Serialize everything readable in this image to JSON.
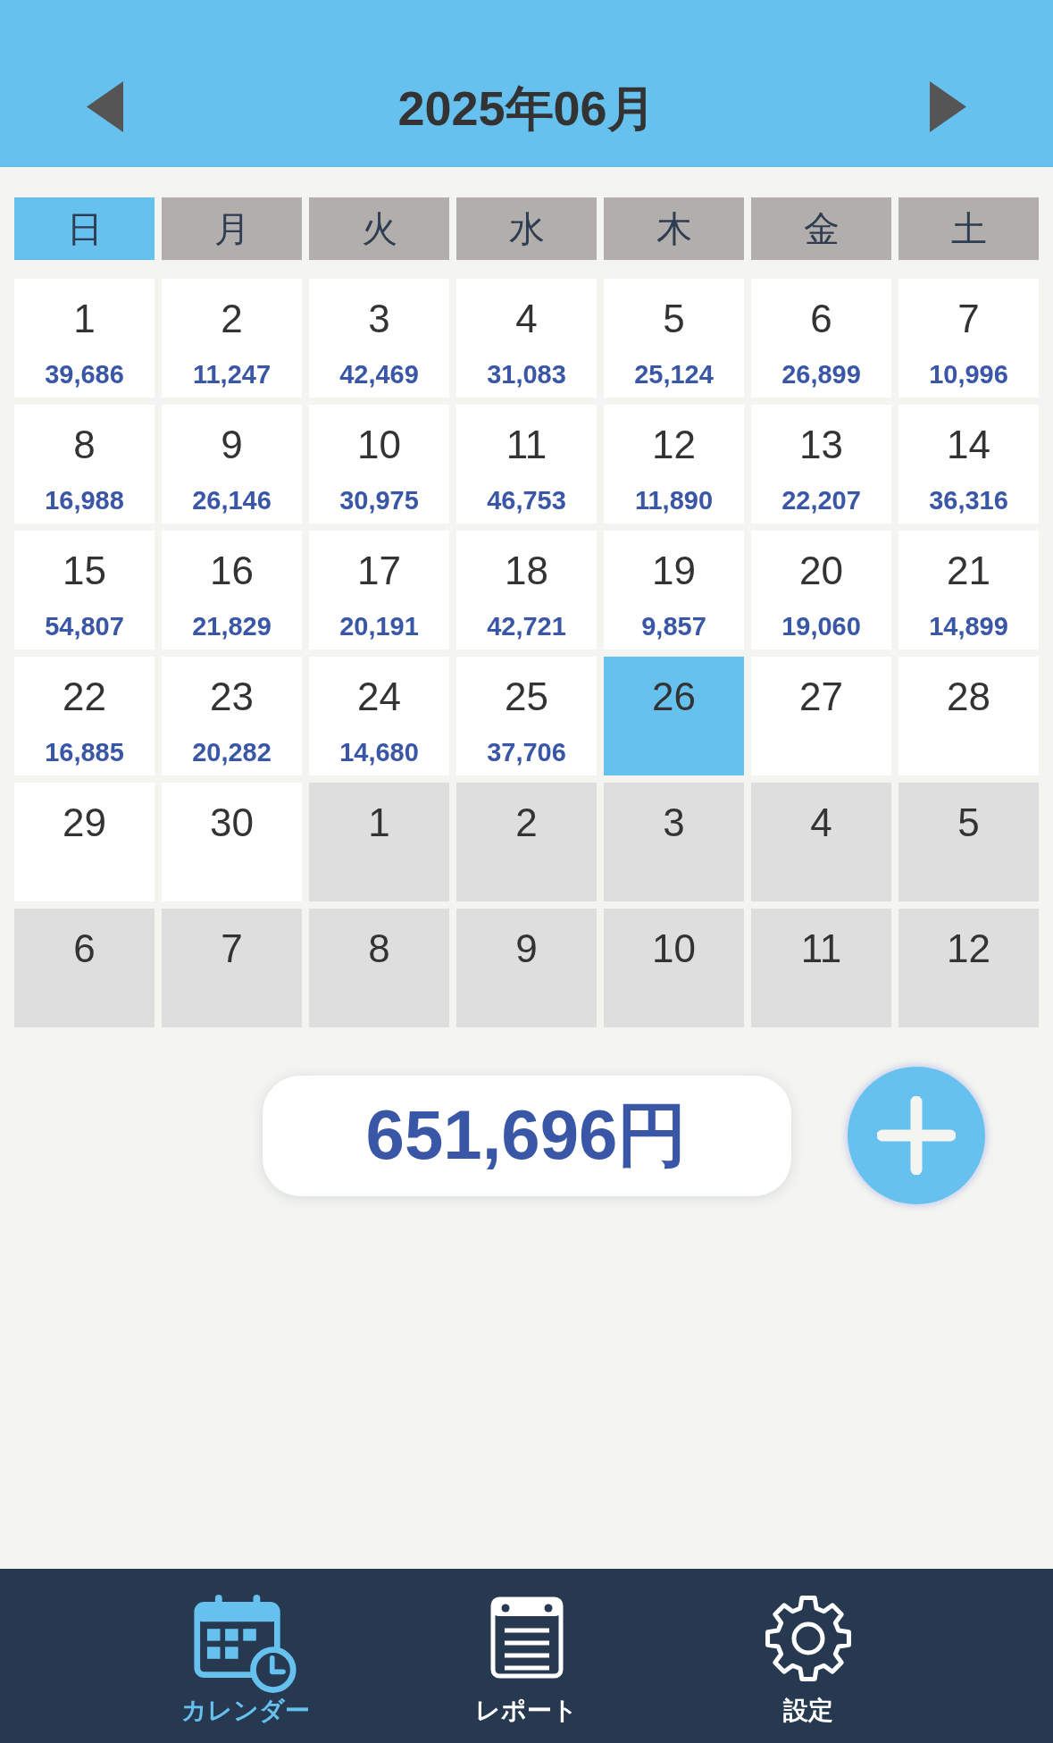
{
  "header": {
    "title": "2025年06月"
  },
  "weekdays": [
    {
      "label": "日",
      "highlighted": true
    },
    {
      "label": "月",
      "highlighted": false
    },
    {
      "label": "火",
      "highlighted": false
    },
    {
      "label": "水",
      "highlighted": false
    },
    {
      "label": "木",
      "highlighted": false
    },
    {
      "label": "金",
      "highlighted": false
    },
    {
      "label": "土",
      "highlighted": false
    }
  ],
  "days": [
    {
      "day": "1",
      "amount": "39,686",
      "in_month": true,
      "today": false
    },
    {
      "day": "2",
      "amount": "11,247",
      "in_month": true,
      "today": false
    },
    {
      "day": "3",
      "amount": "42,469",
      "in_month": true,
      "today": false
    },
    {
      "day": "4",
      "amount": "31,083",
      "in_month": true,
      "today": false
    },
    {
      "day": "5",
      "amount": "25,124",
      "in_month": true,
      "today": false
    },
    {
      "day": "6",
      "amount": "26,899",
      "in_month": true,
      "today": false
    },
    {
      "day": "7",
      "amount": "10,996",
      "in_month": true,
      "today": false
    },
    {
      "day": "8",
      "amount": "16,988",
      "in_month": true,
      "today": false
    },
    {
      "day": "9",
      "amount": "26,146",
      "in_month": true,
      "today": false
    },
    {
      "day": "10",
      "amount": "30,975",
      "in_month": true,
      "today": false
    },
    {
      "day": "11",
      "amount": "46,753",
      "in_month": true,
      "today": false
    },
    {
      "day": "12",
      "amount": "11,890",
      "in_month": true,
      "today": false
    },
    {
      "day": "13",
      "amount": "22,207",
      "in_month": true,
      "today": false
    },
    {
      "day": "14",
      "amount": "36,316",
      "in_month": true,
      "today": false
    },
    {
      "day": "15",
      "amount": "54,807",
      "in_month": true,
      "today": false
    },
    {
      "day": "16",
      "amount": "21,829",
      "in_month": true,
      "today": false
    },
    {
      "day": "17",
      "amount": "20,191",
      "in_month": true,
      "today": false
    },
    {
      "day": "18",
      "amount": "42,721",
      "in_month": true,
      "today": false
    },
    {
      "day": "19",
      "amount": "9,857",
      "in_month": true,
      "today": false
    },
    {
      "day": "20",
      "amount": "19,060",
      "in_month": true,
      "today": false
    },
    {
      "day": "21",
      "amount": "14,899",
      "in_month": true,
      "today": false
    },
    {
      "day": "22",
      "amount": "16,885",
      "in_month": true,
      "today": false
    },
    {
      "day": "23",
      "amount": "20,282",
      "in_month": true,
      "today": false
    },
    {
      "day": "24",
      "amount": "14,680",
      "in_month": true,
      "today": false
    },
    {
      "day": "25",
      "amount": "37,706",
      "in_month": true,
      "today": false
    },
    {
      "day": "26",
      "in_month": true,
      "today": true
    },
    {
      "day": "27",
      "in_month": true,
      "today": false
    },
    {
      "day": "28",
      "in_month": true,
      "today": false
    },
    {
      "day": "29",
      "in_month": true,
      "today": false
    },
    {
      "day": "30",
      "in_month": true,
      "today": false
    },
    {
      "day": "1",
      "in_month": false,
      "today": false
    },
    {
      "day": "2",
      "in_month": false,
      "today": false
    },
    {
      "day": "3",
      "in_month": false,
      "today": false
    },
    {
      "day": "4",
      "in_month": false,
      "today": false
    },
    {
      "day": "5",
      "in_month": false,
      "today": false
    },
    {
      "day": "6",
      "in_month": false,
      "today": false
    },
    {
      "day": "7",
      "in_month": false,
      "today": false
    },
    {
      "day": "8",
      "in_month": false,
      "today": false
    },
    {
      "day": "9",
      "in_month": false,
      "today": false
    },
    {
      "day": "10",
      "in_month": false,
      "today": false
    },
    {
      "day": "11",
      "in_month": false,
      "today": false
    },
    {
      "day": "12",
      "in_month": false,
      "today": false
    }
  ],
  "total": {
    "amount": "651,696円"
  },
  "nav": [
    {
      "label": "カレンダー",
      "kind": "calendar",
      "selected": true
    },
    {
      "label": "レポート",
      "kind": "report",
      "selected": false
    },
    {
      "label": "設定",
      "kind": "settings",
      "selected": false
    }
  ]
}
